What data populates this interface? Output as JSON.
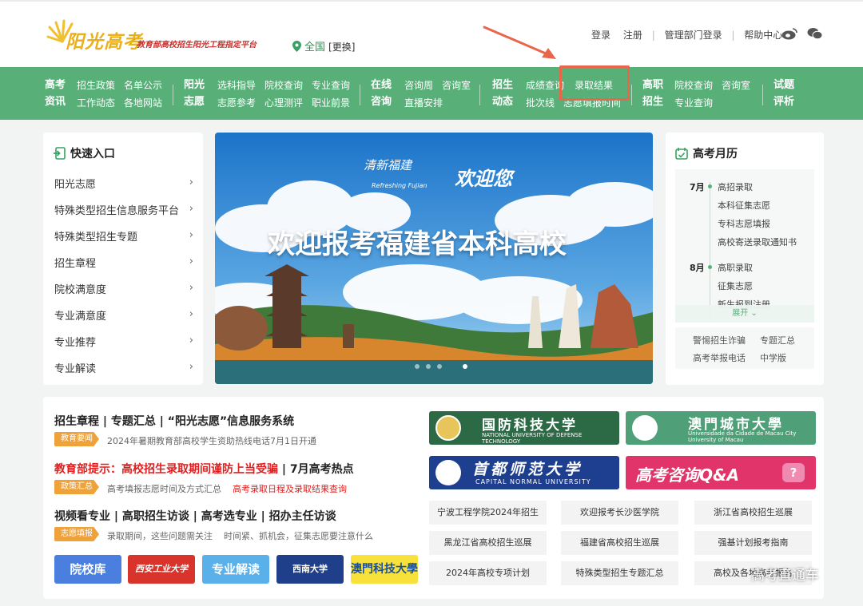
{
  "header": {
    "brand": "阳光高考",
    "slogan": "教育部高校招生阳光工程指定平台",
    "location": "全国",
    "location_change": "[更换]",
    "links": [
      "登录",
      "注册",
      "管理部门登录",
      "帮助中心"
    ],
    "social_icons": [
      "weibo-icon",
      "wechat-icon"
    ]
  },
  "nav": {
    "groups": [
      {
        "title": [
          "高考",
          "资讯"
        ],
        "links": [
          [
            "招生政策",
            "名单公示"
          ],
          [
            "工作动态",
            "各地网站"
          ]
        ]
      },
      {
        "title": [
          "阳光",
          "志愿"
        ],
        "links": [
          [
            "选科指导",
            "院校查询",
            "专业查询"
          ],
          [
            "志愿参考",
            "心理测评",
            "职业前景"
          ]
        ]
      },
      {
        "title": [
          "在线",
          "咨询"
        ],
        "links": [
          [
            "咨询周",
            "咨询室"
          ],
          [
            "直播安排"
          ]
        ]
      },
      {
        "title": [
          "招生",
          "动态"
        ],
        "links": [
          [
            "成绩查询",
            "录取结果"
          ],
          [
            "批次线",
            "志愿填报时间"
          ]
        ]
      },
      {
        "title": [
          "高职",
          "招生"
        ],
        "links": [
          [
            "院校查询",
            "咨询室"
          ],
          [
            "专业查询"
          ]
        ]
      },
      {
        "title": [
          "试题",
          "评析"
        ],
        "links": []
      }
    ],
    "highlight_color": "#e8664a"
  },
  "quick_entry": {
    "title": "快速入口",
    "items": [
      "阳光志愿",
      "特殊类型招生信息服务平台",
      "特殊类型招生专题",
      "招生章程",
      "院校满意度",
      "专业满意度",
      "专业推荐",
      "专业解读"
    ]
  },
  "banner": {
    "tagline_small": "清新福建",
    "tagline_en": "Refreshing Fujian",
    "tagline_welcome": "欢迎您",
    "headline": "欢迎报考福建省本科高校",
    "slide_count": 4,
    "active_slide": 4
  },
  "calendar": {
    "title": "高考月历",
    "months": [
      {
        "month": "7月",
        "items": [
          "高招录取",
          "本科征集志愿",
          "专科志愿填报",
          "高校寄送录取通知书"
        ]
      },
      {
        "month": "8月",
        "items": [
          "高职录取",
          "征集志愿",
          "新生报到注册"
        ]
      }
    ],
    "expand_label": "展开",
    "links": [
      "警惕招生诈骗",
      "专题汇总",
      "高考举报电话",
      "中学版"
    ]
  },
  "bottom": {
    "rows": [
      {
        "title_parts": [
          "招生章程",
          "专题汇总",
          "“阳光志愿”信息服务系统"
        ],
        "tag": "教育要闻",
        "sub": [
          "2024年暑期教育部高校学生资助热线电话7月1日开通"
        ]
      },
      {
        "title_parts": [
          "教育部提示：高校招生录取期间谨防上当受骗",
          "7月高考热点"
        ],
        "tag": "政策汇总",
        "sub": [
          "高考填报志愿时间及方式汇总",
          "高考录取日程及录取结果查询"
        ]
      },
      {
        "title_parts": [
          "视频看专业",
          "高职招生访谈",
          "高考选专业",
          "招办主任访谈"
        ],
        "tag": "志愿填报",
        "sub": [
          "录取期间，这些问题需关注",
          "时间紧、抓机会，征集志愿要注意什么"
        ]
      }
    ],
    "logo_tiles": [
      "院校库",
      "西安工业大学",
      "专业解读",
      "西南大学",
      "澳門科技大學"
    ],
    "universities": [
      {
        "name": "国防科技大学",
        "en": "NATIONAL UNIVERSITY OF DEFENSE TECHNOLOGY"
      },
      {
        "name": "澳門城市大學",
        "en": "Universidade da Cidade de Macau City University of Macau"
      },
      {
        "name": "首都师范大学",
        "en": "CAPITAL NORMAL UNIVERSITY"
      },
      {
        "name": "高考咨询Q&A",
        "en": "?"
      }
    ],
    "links": [
      "宁波工程学院2024年招生",
      "欢迎报考长沙医学院",
      "浙江省高校招生巡展",
      "黑龙江省高校招生巡展",
      "福建省高校招生巡展",
      "强基计划报考指南",
      "2024年高校专项计划",
      "特殊类型招生专题汇总",
      "高校及各地高考报名"
    ]
  },
  "watermark": "高考直通车"
}
